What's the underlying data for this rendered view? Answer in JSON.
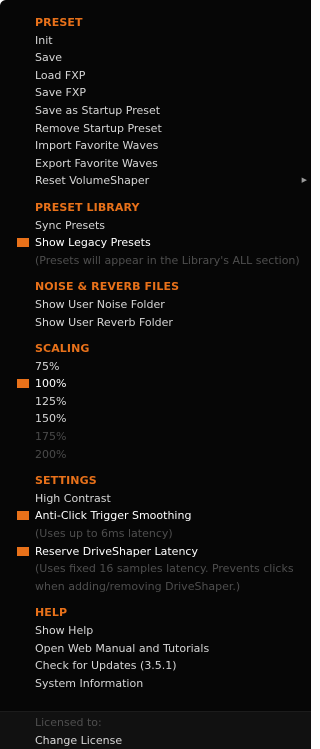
{
  "colors": {
    "accent": "#e8711a",
    "background": "#060606",
    "text": "#d6d6d6",
    "disabled": "#4a4a4a"
  },
  "sections": [
    {
      "header": "PRESET",
      "items": [
        {
          "label": "Init"
        },
        {
          "label": "Save"
        },
        {
          "label": "Load FXP"
        },
        {
          "label": "Save FXP"
        },
        {
          "label": "Save as Startup Preset"
        },
        {
          "label": "Remove Startup Preset"
        },
        {
          "label": "Import Favorite Waves"
        },
        {
          "label": "Export Favorite Waves"
        },
        {
          "label": "Reset VolumeShaper",
          "submenu_icon": "chevron-right-icon"
        }
      ]
    },
    {
      "header": "PRESET LIBRARY",
      "items": [
        {
          "label": "Sync Presets"
        },
        {
          "label": "Show Legacy Presets",
          "checked": true
        },
        {
          "label": "(Presets will appear in the Library's ALL section)",
          "note": true
        }
      ]
    },
    {
      "header": "NOISE & REVERB FILES",
      "items": [
        {
          "label": "Show User Noise Folder"
        },
        {
          "label": "Show User Reverb Folder"
        }
      ]
    },
    {
      "header": "SCALING",
      "items": [
        {
          "label": "75%"
        },
        {
          "label": "100%",
          "checked": true
        },
        {
          "label": "125%"
        },
        {
          "label": "150%"
        },
        {
          "label": "175%",
          "disabled": true
        },
        {
          "label": "200%",
          "disabled": true
        }
      ]
    },
    {
      "header": "SETTINGS",
      "items": [
        {
          "label": "High Contrast"
        },
        {
          "label": "Anti-Click Trigger Smoothing",
          "checked": true
        },
        {
          "label": "(Uses up to 6ms latency)",
          "note": true
        },
        {
          "label": "Reserve DriveShaper Latency",
          "checked": true
        },
        {
          "label": "(Uses fixed 16 samples latency. Prevents clicks",
          "note": true
        },
        {
          "label": "when adding/removing DriveShaper.)",
          "note": true
        }
      ]
    },
    {
      "header": "HELP",
      "items": [
        {
          "label": "Show Help"
        },
        {
          "label": "Open Web Manual and Tutorials"
        },
        {
          "label": "Check for Updates (3.5.1)"
        },
        {
          "label": "System Information"
        }
      ]
    }
  ],
  "footer": {
    "licensed_label": "Licensed to:",
    "change_license": "Change License"
  }
}
